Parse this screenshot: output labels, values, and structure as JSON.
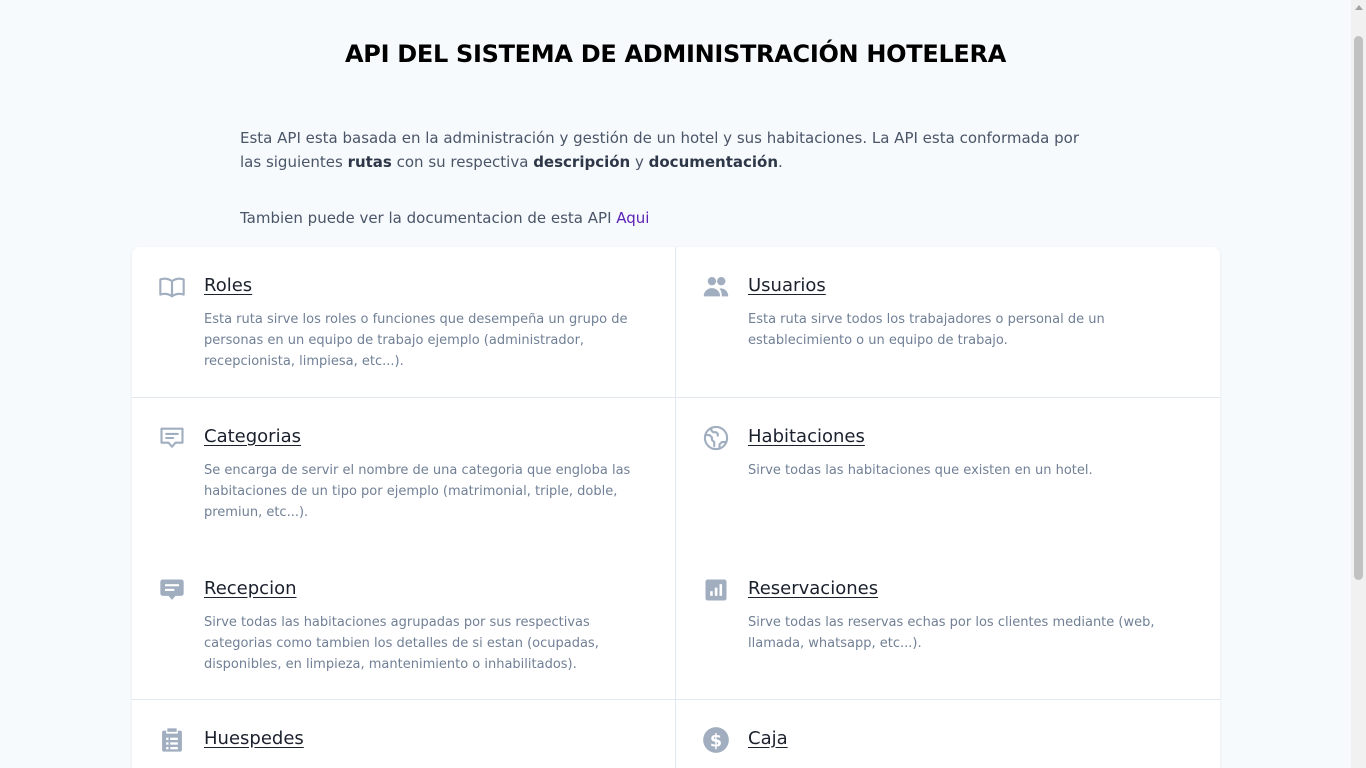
{
  "page": {
    "title": "API DEL SISTEMA DE ADMINISTRACIÓN HOTELERA"
  },
  "intro": {
    "text_1": "Esta API esta basada en la administración y gestión de un hotel y sus habitaciones. La API esta conformada por las siguientes ",
    "bold_1": "rutas",
    "text_2": " con su respectiva ",
    "bold_2": "descripción",
    "text_3": " y ",
    "bold_3": "documentación",
    "text_4": "."
  },
  "docs": {
    "text": "Tambien puede ver la documentacion de esta API ",
    "link": "Aqui",
    "link_color": "#5b21b6"
  },
  "routes": [
    {
      "icon": "book-open-icon",
      "title": "Roles",
      "description": "Esta ruta sirve los roles o funciones que desempeña un grupo de personas en un equipo de trabajo ejemplo (administrador, recepcionista, limpiesa, etc...)."
    },
    {
      "icon": "users-icon",
      "title": "Usuarios",
      "description": "Esta ruta sirve todos los trabajadores o personal de un establecimiento o un equipo de trabajo."
    },
    {
      "icon": "chat-alt-icon",
      "title": "Categorias",
      "description": "Se encarga de servir el nombre de una categoria que engloba las habitaciones de un tipo por ejemplo (matrimonial, triple, doble, premiun, etc...)."
    },
    {
      "icon": "globe-icon",
      "title": "Habitaciones",
      "description": "Sirve todas las habitaciones que existen en un hotel."
    },
    {
      "icon": "message-icon",
      "title": "Recepcion",
      "description": "Sirve todas las habitaciones agrupadas por sus respectivas categorias como tambien los detalles de si estan (ocupadas, disponibles, en limpieza, mantenimiento o inhabilitados)."
    },
    {
      "icon": "chart-bar-icon",
      "title": "Reservaciones",
      "description": "Sirve todas las reservas echas por los clientes mediante (web, llamada, whatsapp, etc...)."
    },
    {
      "icon": "clipboard-list-icon",
      "title": "Huespedes",
      "description": ""
    },
    {
      "icon": "currency-dollar-icon",
      "title": "Caja",
      "description": ""
    }
  ]
}
